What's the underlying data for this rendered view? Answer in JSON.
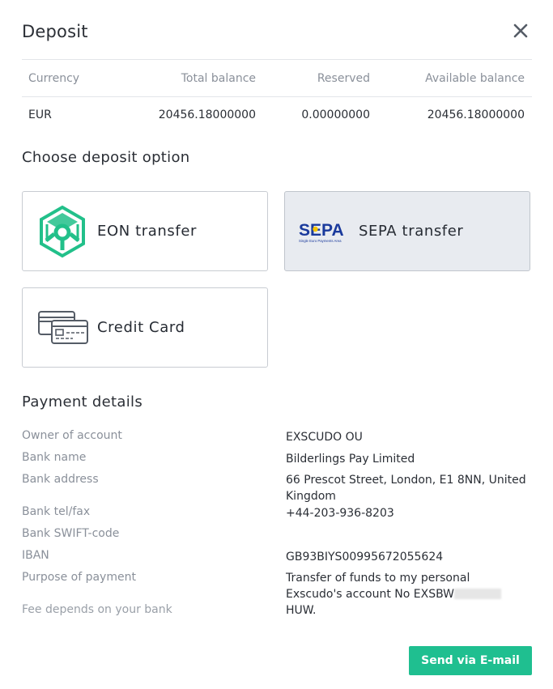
{
  "modal": {
    "title": "Deposit",
    "close_icon": "close-icon"
  },
  "balance_table": {
    "headers": [
      "Currency",
      "Total balance",
      "Reserved",
      "Available balance"
    ],
    "rows": [
      [
        "EUR",
        "20456.18000000",
        "0.00000000",
        "20456.18000000"
      ]
    ]
  },
  "deposit_options": {
    "title": "Choose deposit option",
    "items": [
      {
        "label": "EON transfer",
        "icon": "eon-logo-icon",
        "selected": false
      },
      {
        "label": "SEPA transfer",
        "icon": "sepa-logo-icon",
        "logo_text": "SEPA",
        "logo_subtext": "Single Euro Payments Area",
        "selected": true
      },
      {
        "label": "Credit Card",
        "icon": "credit-card-icon",
        "selected": false
      }
    ]
  },
  "payment_details": {
    "title": "Payment details",
    "rows": [
      {
        "key": "Owner of account",
        "value": "EXSCUDO OU"
      },
      {
        "key": "Bank name",
        "value": "Bilderlings Pay Limited"
      },
      {
        "key": "Bank address",
        "value": "66 Prescot Street, London, E1 8NN, United Kingdom"
      },
      {
        "key": "Bank tel/fax",
        "value": "+44-203-936-8203"
      },
      {
        "key": "Bank SWIFT-code",
        "value": ""
      },
      {
        "key": "IBAN",
        "value": "GB93BIYS00995672055624"
      },
      {
        "key": "Purpose of payment",
        "value_prefix": "Transfer of funds to my personal Exscudo's account No EXSBW",
        "value_suffix": "HUW."
      }
    ],
    "fee_note": "Fee depends on your bank"
  },
  "actions": {
    "send_label": "Send via E-mail"
  },
  "colors": {
    "accent": "#1fbf90",
    "eon_green": "#22c08a",
    "sepa_blue": "#1a3a9c",
    "sepa_yellow": "#f5c400",
    "selected_bg": "#e8ebf0"
  }
}
